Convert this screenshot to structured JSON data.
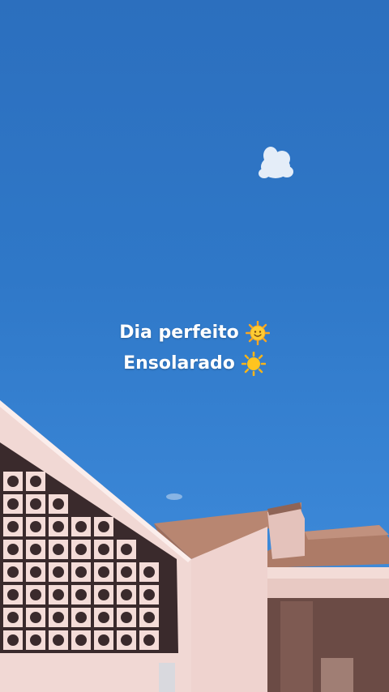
{
  "caption": {
    "line1": "Dia perfeito",
    "line1_icon": "smiling-sun-emoji",
    "line2": "Ensolarado",
    "line2_icon": "sun-emoji"
  },
  "colors": {
    "sky": "#2f78c8",
    "wall": "#f1d6d2",
    "roof": "#b07f6c",
    "text": "#ffffff"
  }
}
